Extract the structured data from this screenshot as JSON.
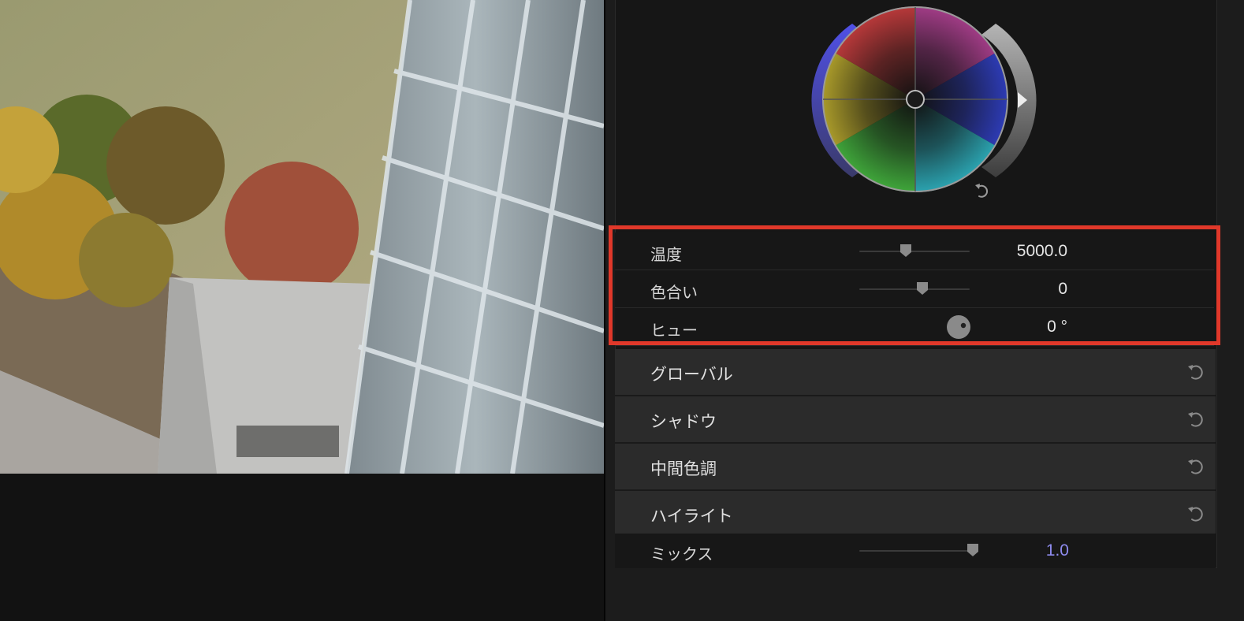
{
  "params": [
    {
      "label": "温度",
      "value": "5000.0",
      "slider_fraction": 0.35
    },
    {
      "label": "色合い",
      "value": "0",
      "slider_fraction": 0.5
    },
    {
      "label": "ヒュー",
      "value": "0 °"
    }
  ],
  "sections": [
    {
      "label": "グローバル"
    },
    {
      "label": "シャドウ"
    },
    {
      "label": "中間色調"
    },
    {
      "label": "ハイライト"
    }
  ],
  "mix": {
    "label": "ミックス",
    "value": "1.0",
    "slider_fraction": 0.95
  },
  "colors": {
    "highlight_box": "#e0382a",
    "mix_value": "#8f8cf0",
    "wheel_left_handle": "#4b4bd8",
    "wheel_right_handle": "#8a8a8a"
  },
  "icons": {
    "reset": "reset-icon",
    "hue_knob": "hue-dial-icon"
  }
}
